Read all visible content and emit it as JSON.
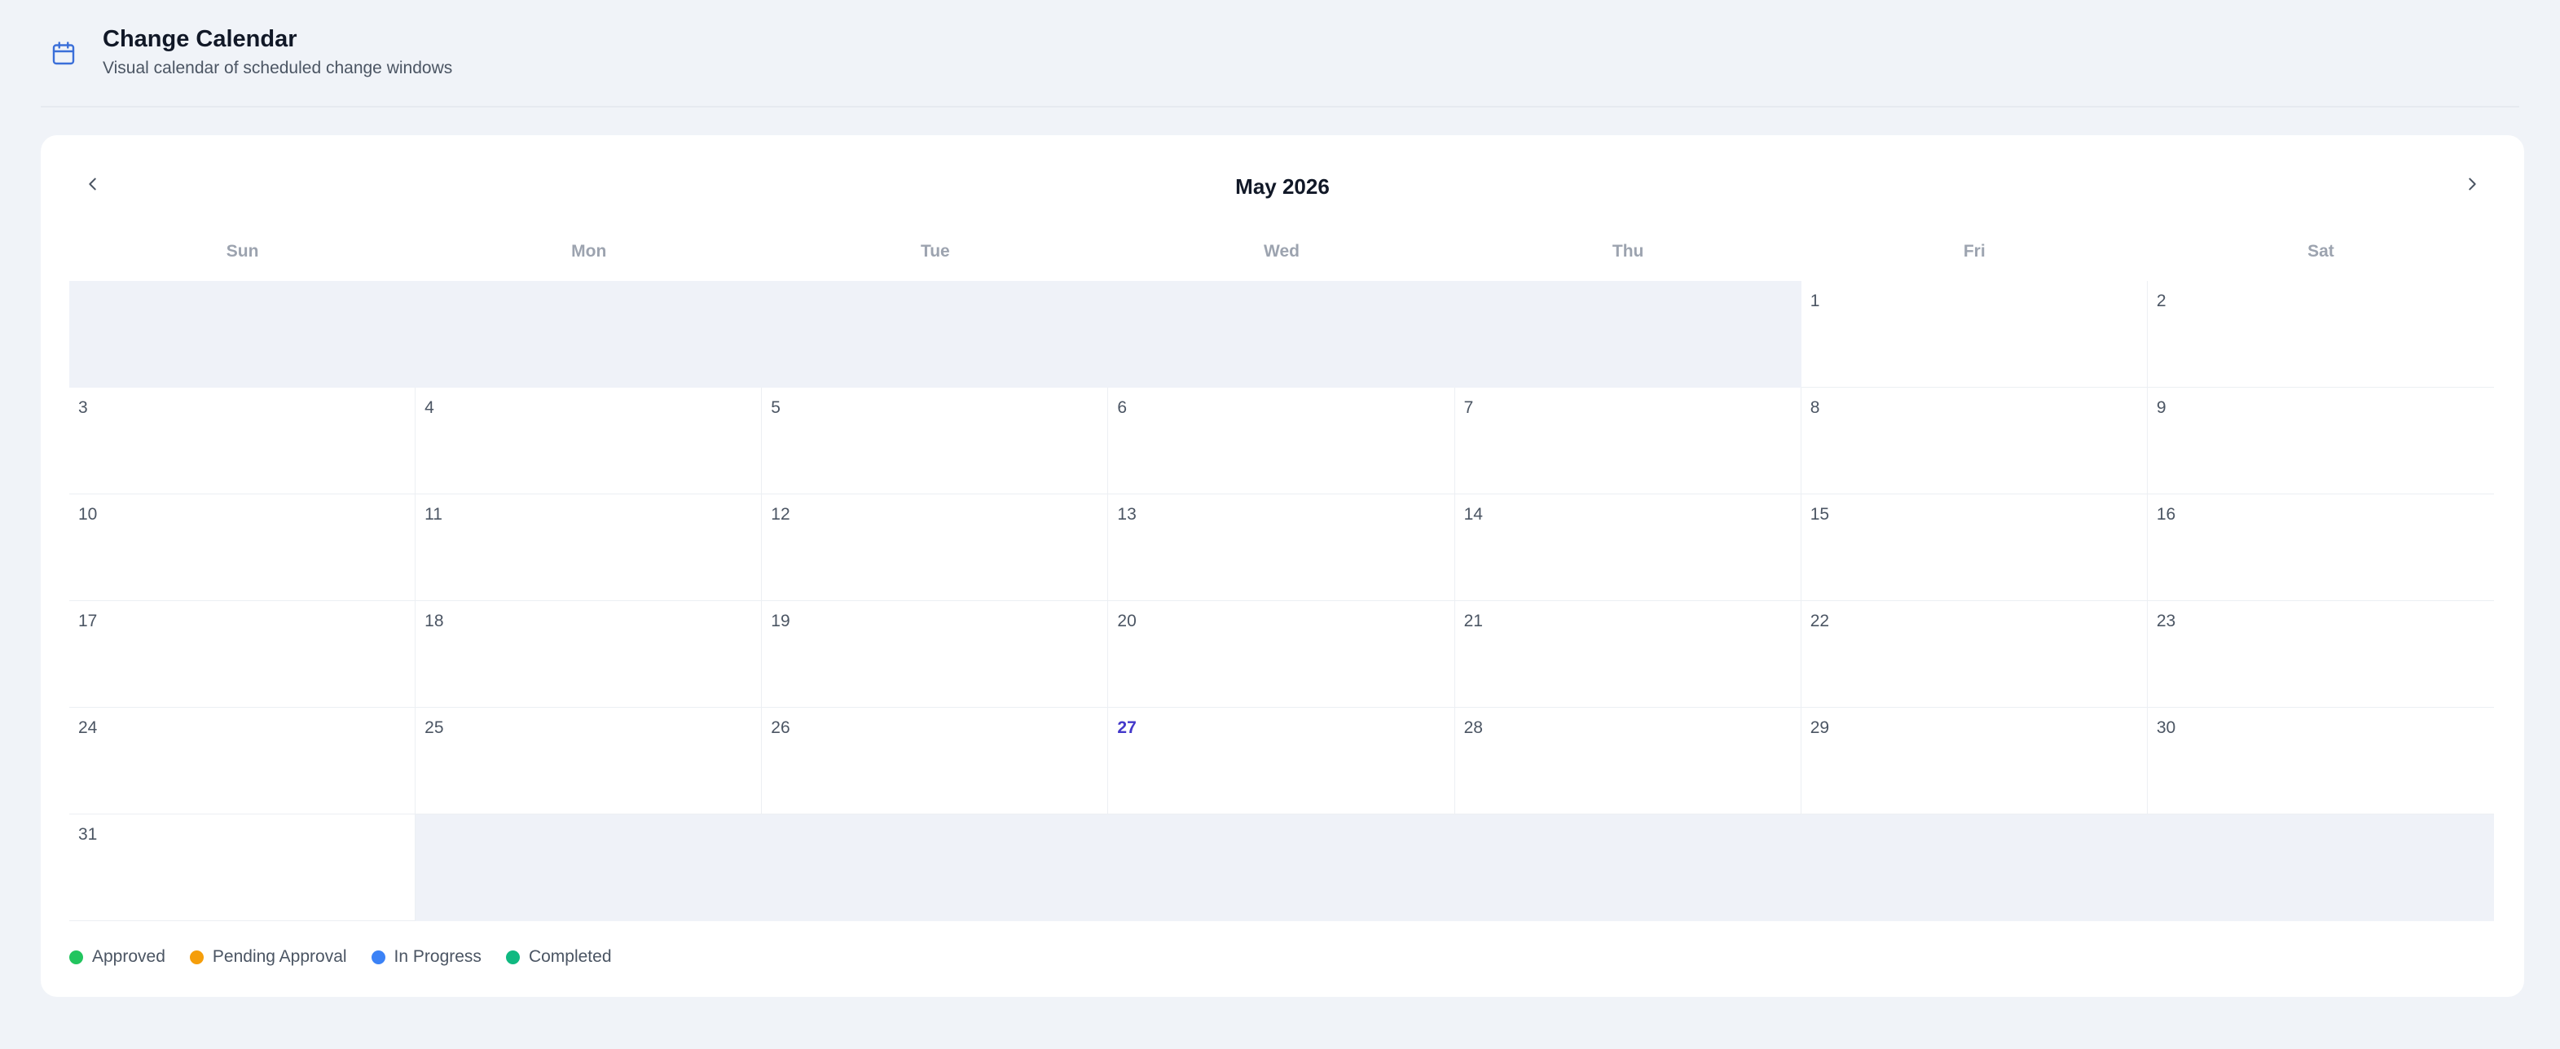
{
  "header": {
    "title": "Change Calendar",
    "subtitle": "Visual calendar of scheduled change windows",
    "icon": "calendar-icon"
  },
  "calendar": {
    "month_label": "May 2026",
    "prev_icon": "chevron-left-icon",
    "next_icon": "chevron-right-icon",
    "weekdays": [
      "Sun",
      "Mon",
      "Tue",
      "Wed",
      "Thu",
      "Fri",
      "Sat"
    ],
    "first_weekday_index": 5,
    "days_in_month": 31,
    "today": 27,
    "weeks": 6
  },
  "legend": [
    {
      "label": "Approved",
      "color": "#22c55e"
    },
    {
      "label": "Pending Approval",
      "color": "#f59e0b"
    },
    {
      "label": "In Progress",
      "color": "#3b82f6"
    },
    {
      "label": "Completed",
      "color": "#10b981"
    }
  ],
  "colors": {
    "accent": "#3b6fd9",
    "today": "#4338ca"
  }
}
